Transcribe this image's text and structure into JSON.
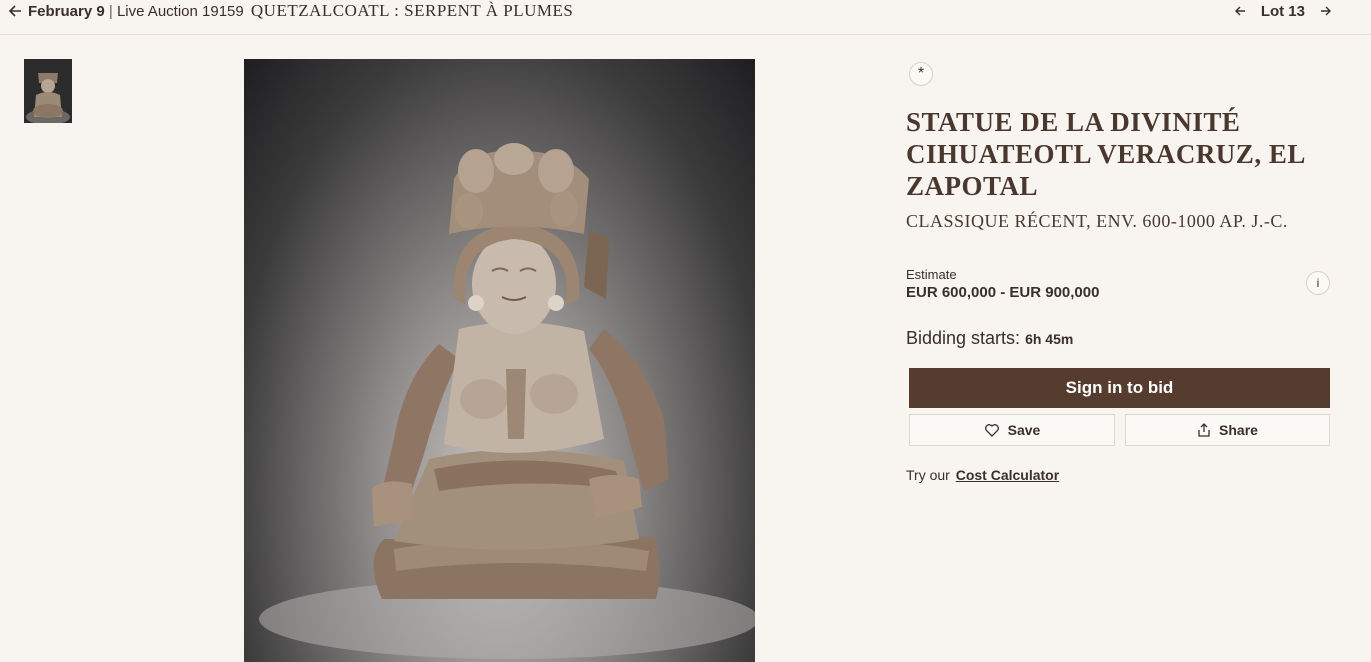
{
  "header": {
    "date": "February 9",
    "separator": "|",
    "auction": "Live Auction 19159",
    "sale_title": "QUETZALCOATL : SERPENT À PLUMES",
    "lot_label": "Lot 13"
  },
  "lot": {
    "title": "STATUE DE LA DIVINITÉ CIHUATEOTL VERACRUZ, EL ZAPOTAL",
    "subtitle": "CLASSIQUE RÉCENT, ENV. 600-1000 AP. J.-C.",
    "estimate_label": "Estimate",
    "estimate_value": "EUR 600,000 - EUR 900,000",
    "bidding_label": "Bidding starts:",
    "bidding_time": "6h 45m",
    "info_glyph": "i",
    "pin_glyph": "*"
  },
  "actions": {
    "signin_label": "Sign in to bid",
    "save_label": "Save",
    "share_label": "Share",
    "calc_prefix": "Try our",
    "calc_link": "Cost Calculator"
  },
  "icons": [
    "arrow-left-icon",
    "arrow-right-icon",
    "heart-icon",
    "share-icon",
    "asterisk-icon",
    "info-icon"
  ],
  "colors": {
    "brand": "#553c2f",
    "background": "#f8f5f1",
    "title": "#4a382e"
  }
}
